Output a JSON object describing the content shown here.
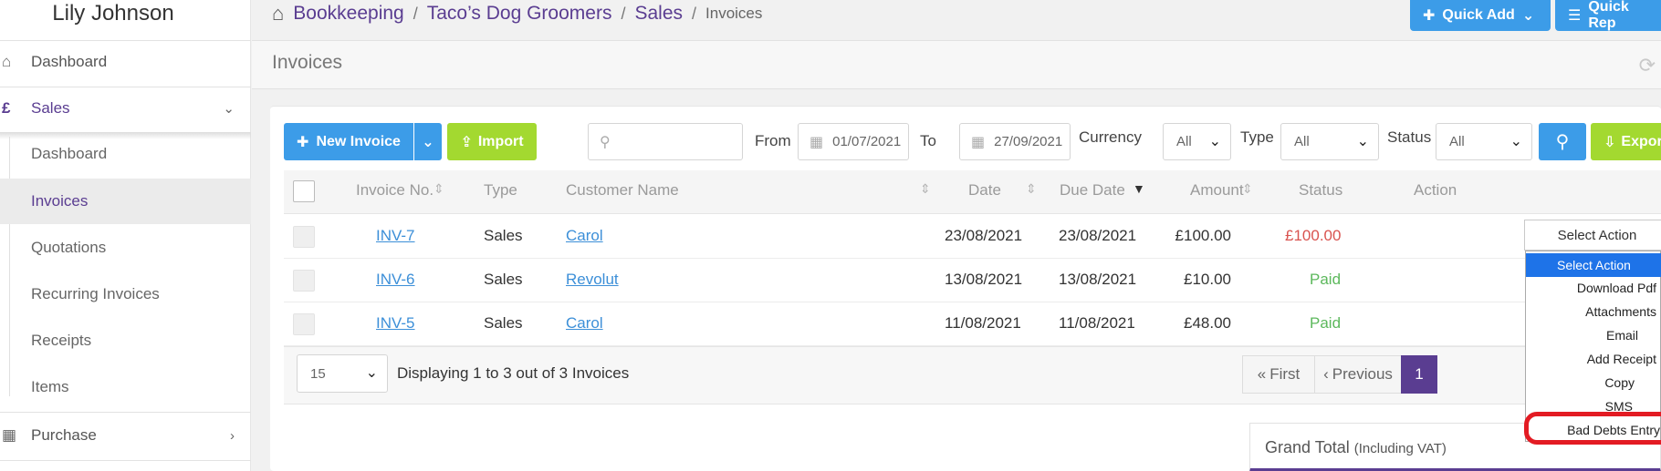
{
  "user": {
    "name": "Lily Johnson"
  },
  "sidebar": {
    "dashboard": "Dashboard",
    "sales": "Sales",
    "sales_items": [
      "Dashboard",
      "Invoices",
      "Quotations",
      "Recurring Invoices",
      "Receipts",
      "Items"
    ],
    "purchase": "Purchase",
    "currency_icon": "£"
  },
  "breadcrumb": {
    "items": [
      "Bookkeeping",
      "Taco’s Dog Groomers",
      "Sales"
    ],
    "current": "Invoices"
  },
  "header": {
    "quick_add": "Quick Add",
    "quick_rep": "Quick Rep"
  },
  "page": {
    "title": "Invoices"
  },
  "toolbar": {
    "new_invoice": "New Invoice",
    "import": "Import",
    "search_placeholder": "",
    "from_label": "From",
    "from_date": "01/07/2021",
    "to_label": "To",
    "to_date": "27/09/2021",
    "currency_label": "Currency",
    "currency_value": "All",
    "type_label": "Type",
    "type_value": "All",
    "status_label": "Status",
    "status_value": "All",
    "export": "Export"
  },
  "table": {
    "columns": [
      "Invoice No.",
      "Type",
      "Customer Name",
      "Date",
      "Due Date",
      "Amount",
      "Status",
      "Action"
    ],
    "rows": [
      {
        "invoice": "INV-7",
        "type": "Sales",
        "customer": "Carol",
        "date": "23/08/2021",
        "due": "23/08/2021",
        "amount": "£100.00",
        "status": "£100.00"
      },
      {
        "invoice": "INV-6",
        "type": "Sales",
        "customer": "Revolut",
        "date": "13/08/2021",
        "due": "13/08/2021",
        "amount": "£10.00",
        "status": "Paid"
      },
      {
        "invoice": "INV-5",
        "type": "Sales",
        "customer": "Carol",
        "date": "11/08/2021",
        "due": "11/08/2021",
        "amount": "£48.00",
        "status": "Paid"
      }
    ],
    "action_select": "Select Action"
  },
  "footer": {
    "per_page": "15",
    "display_text": "Displaying 1 to 3 out of 3 Invoices",
    "first": "First",
    "previous": "Previous",
    "page_partial": "1"
  },
  "grand_total": {
    "title": "Grand Total",
    "subtitle": "(Including VAT)"
  },
  "action_menu": {
    "items": [
      "Select Action",
      "Download Pdf",
      "Attachments",
      "Email",
      "Add Receipt",
      "Copy",
      "SMS",
      "Bad Debts Entry"
    ]
  },
  "colors": {
    "brand": "#5a3d91",
    "primary": "#3c9ce8",
    "success": "#a3d930",
    "highlight": "#e31b23"
  }
}
